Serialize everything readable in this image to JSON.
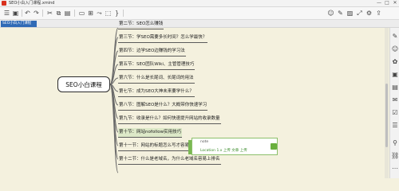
{
  "window": {
    "title": "SEO小白入门课程.xmind",
    "minimize": "—",
    "maximize": "□",
    "close": "✕"
  },
  "toolbar": {
    "icons": [
      "menu-icon",
      "save-icon",
      "undo-icon",
      "redo-icon",
      "cut-icon",
      "copy-icon",
      "paste-icon",
      "format-icon",
      "topic-icon",
      "subtopic-icon",
      "relationship-icon",
      "boundary-icon",
      "summary-icon",
      "marker-icon",
      "note-icon",
      "image-icon",
      "expand-icon",
      "settings-icon"
    ]
  },
  "tabs": {
    "active": "SEO小白入门课程"
  },
  "mindmap": {
    "root": "SEO小白课程",
    "children": [
      "第二节：SEO怎么赚钱",
      "第三节：学SEO需要多长时间？怎么学最快？",
      "第四节：边学SEO边赚钱的学习法",
      "第五节：SEO团队Wiki、主管管理技巧",
      "第六节：什么是长尾词、长尾词的用法",
      "第七节：成为SEO大神未来要学什么？",
      "第八节：图解SEO是什么？大概带你快速学习",
      "第九节：收录是什么？如何快速提升网站的收录数量",
      "第十节：网站nofollow实用技巧",
      "第十一节：网站的标题怎么写才容易排名",
      "第十二节：什么是老域名，为什么老域名容易上排名"
    ],
    "selected_index": 8,
    "popup": {
      "label": "note",
      "url": "Location 1.x 上传 文章 上传"
    }
  }
}
